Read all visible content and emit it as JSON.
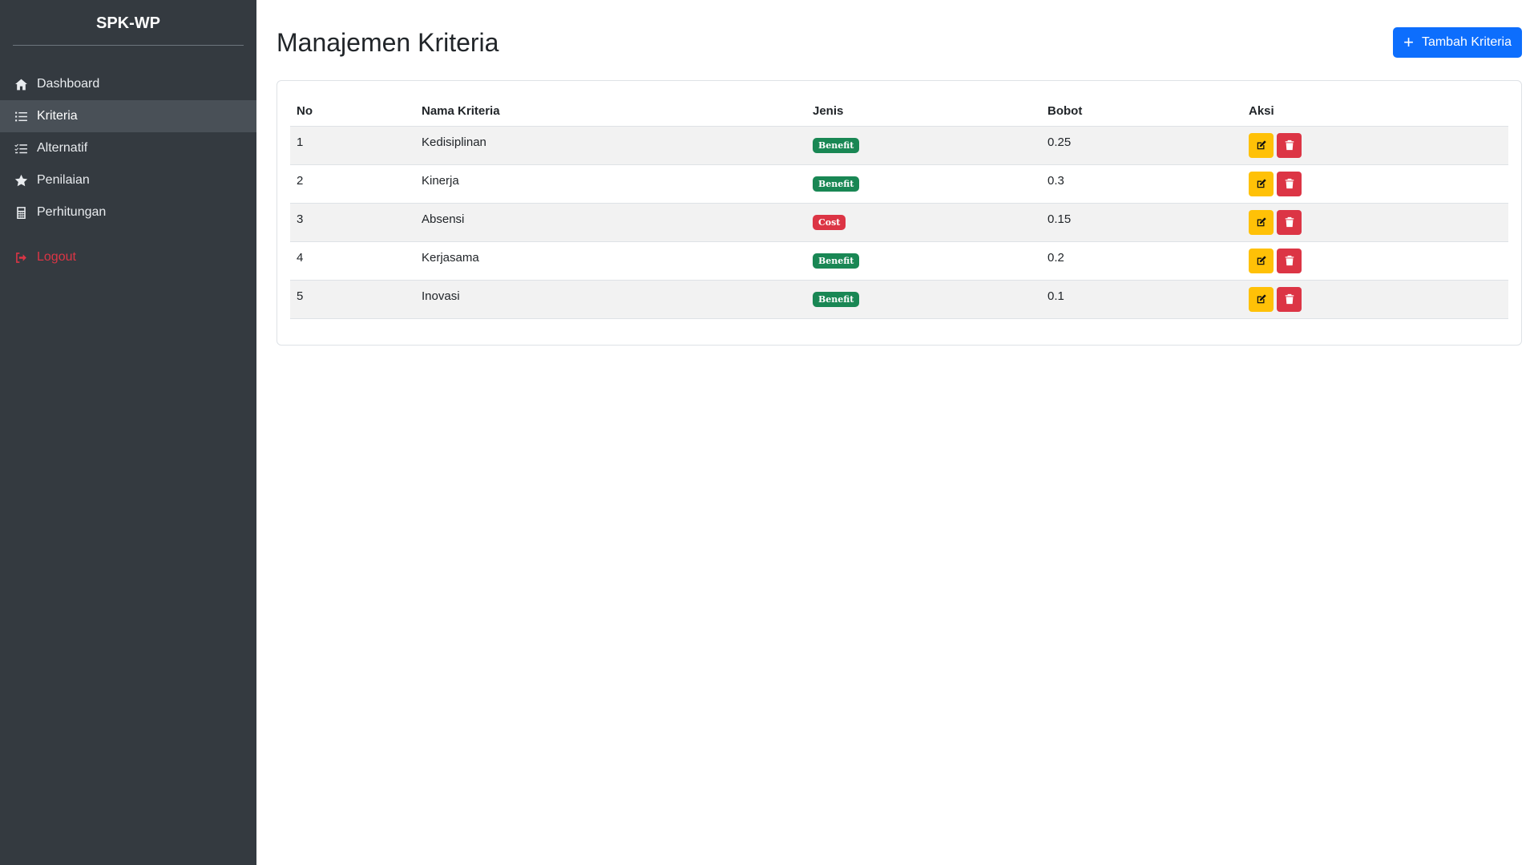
{
  "app": {
    "brand": "SPK-WP"
  },
  "sidebar": {
    "items": [
      {
        "label": "Dashboard",
        "icon": "home-icon",
        "active": false
      },
      {
        "label": "Kriteria",
        "icon": "list-icon",
        "active": true
      },
      {
        "label": "Alternatif",
        "icon": "checklist-icon",
        "active": false
      },
      {
        "label": "Penilaian",
        "icon": "star-icon",
        "active": false
      },
      {
        "label": "Perhitungan",
        "icon": "calculator-icon",
        "active": false
      }
    ],
    "logout": {
      "label": "Logout",
      "icon": "sign-out-icon",
      "color": "#dc3545"
    }
  },
  "main": {
    "title": "Manajemen Kriteria",
    "add_button": {
      "label": "Tambah Kriteria",
      "icon": "plus-icon",
      "color": "#0d6efd"
    }
  },
  "table": {
    "headers": [
      "No",
      "Nama Kriteria",
      "Jenis",
      "Bobot",
      "Aksi"
    ],
    "rows": [
      {
        "no": "1",
        "nama": "Kedisiplinan",
        "jenis": "Benefit",
        "bobot": "0.25"
      },
      {
        "no": "2",
        "nama": "Kinerja",
        "jenis": "Benefit",
        "bobot": "0.3"
      },
      {
        "no": "3",
        "nama": "Absensi",
        "jenis": "Cost",
        "bobot": "0.15"
      },
      {
        "no": "4",
        "nama": "Kerjasama",
        "jenis": "Benefit",
        "bobot": "0.2"
      },
      {
        "no": "5",
        "nama": "Inovasi",
        "jenis": "Benefit",
        "bobot": "0.1"
      }
    ],
    "badge_colors": {
      "Benefit": "#198754",
      "Cost": "#dc3545"
    },
    "action_colors": {
      "edit": "#ffc107",
      "delete": "#dc3545"
    }
  }
}
